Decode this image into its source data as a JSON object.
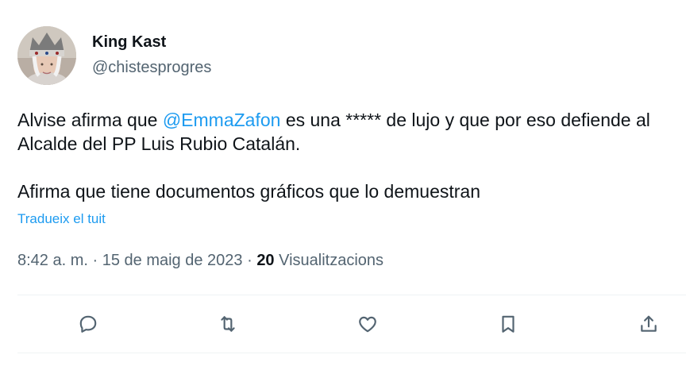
{
  "author": {
    "name": "King Kast",
    "handle": "@chistesprogres"
  },
  "tweet": {
    "line1_before": "Alvise afirma que ",
    "mention": "@EmmaZafon",
    "line1_after": " es una ***** de lujo y que por eso defiende al Alcalde del PP Luis Rubio Catalán.",
    "paragraph2": "Afirma que tiene documentos gráficos que lo demuestran",
    "translate_label": "Tradueix el tuit"
  },
  "meta": {
    "time": "8:42 a. m.",
    "separator": " · ",
    "date": "15 de maig de 2023",
    "views_count": "20",
    "views_label": "Visualitzacions"
  },
  "actions": [
    {
      "icon": "reply-icon"
    },
    {
      "icon": "retweet-icon"
    },
    {
      "icon": "like-icon"
    },
    {
      "icon": "bookmark-icon"
    },
    {
      "icon": "share-icon"
    }
  ],
  "colors": {
    "link": "#1d9bf0",
    "text": "#0f1419",
    "secondary": "#536471",
    "divider": "#eff3f4"
  }
}
